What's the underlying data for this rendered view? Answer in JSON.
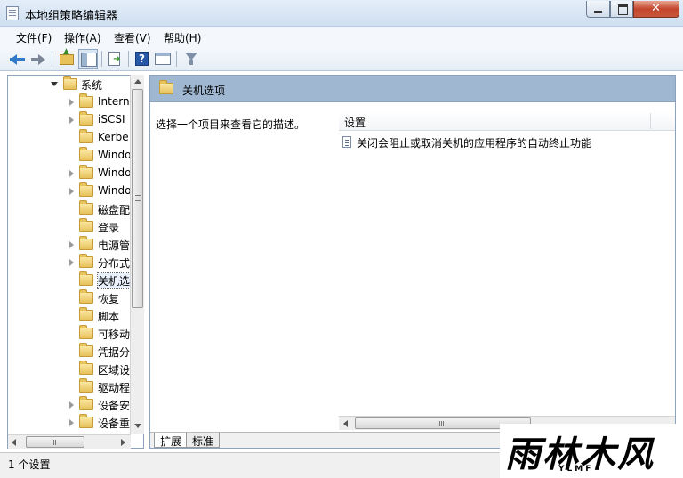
{
  "window": {
    "title": "本地组策略编辑器"
  },
  "menu": [
    "文件(F)",
    "操作(A)",
    "查看(V)",
    "帮助(H)"
  ],
  "tree": {
    "items": [
      {
        "label": "系统",
        "twist": "open"
      },
      {
        "label": "Intern",
        "twist": "closed"
      },
      {
        "label": "iSCSI",
        "twist": "closed"
      },
      {
        "label": "Kerbe",
        "twist": "none"
      },
      {
        "label": "Windo",
        "twist": "none"
      },
      {
        "label": "Windo",
        "twist": "closed"
      },
      {
        "label": "Windo",
        "twist": "closed"
      },
      {
        "label": "磁盘配",
        "twist": "none"
      },
      {
        "label": "登录",
        "twist": "none"
      },
      {
        "label": "电源管",
        "twist": "closed"
      },
      {
        "label": "分布式",
        "twist": "closed"
      },
      {
        "label": "关机选",
        "twist": "none",
        "selected": true
      },
      {
        "label": "恢复",
        "twist": "none"
      },
      {
        "label": "脚本",
        "twist": "none"
      },
      {
        "label": "可移动",
        "twist": "none"
      },
      {
        "label": "凭据分",
        "twist": "none"
      },
      {
        "label": "区域设",
        "twist": "none"
      },
      {
        "label": "驱动程",
        "twist": "none"
      },
      {
        "label": "设备安",
        "twist": "closed"
      },
      {
        "label": "设备重",
        "twist": "closed"
      }
    ]
  },
  "right": {
    "title": "关机选项",
    "description": "选择一个项目来查看它的描述。",
    "column_header": "设置",
    "settings": [
      "关闭会阻止或取消关机的应用程序的自动终止功能"
    ]
  },
  "tabs": [
    "扩展",
    "标准"
  ],
  "status": "1 个设置",
  "watermark": {
    "text": "雨林木风",
    "sub": "YLMF"
  }
}
